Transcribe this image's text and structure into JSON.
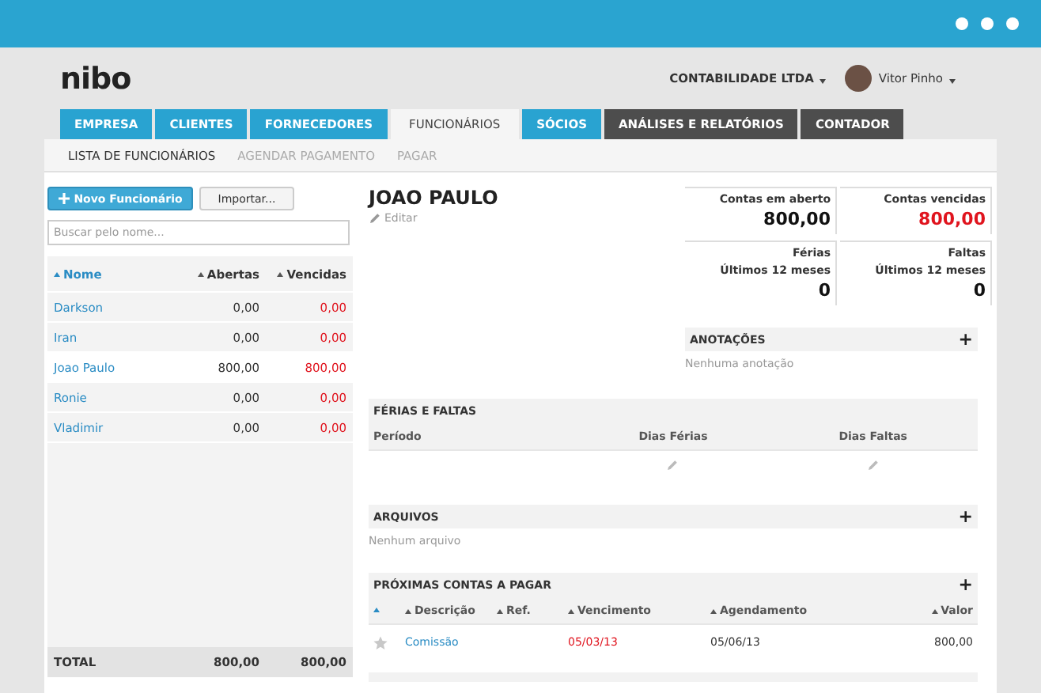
{
  "logo": "nibo",
  "account": {
    "company": "CONTABILIDADE LTDA",
    "user": "Vitor Pinho"
  },
  "tabs": [
    {
      "label": "EMPRESA",
      "selected": false,
      "kind": "module"
    },
    {
      "label": "CLIENTES",
      "selected": false,
      "kind": "module"
    },
    {
      "label": "FORNECEDORES",
      "selected": false,
      "kind": "module"
    },
    {
      "label": "FUNCIONÁRIOS",
      "selected": true,
      "kind": "module"
    },
    {
      "label": "SÓCIOS",
      "selected": false,
      "kind": "module"
    },
    {
      "label": "ANÁLISES E RELATÓRIOS",
      "selected": false,
      "kind": "tool"
    },
    {
      "label": "CONTADOR",
      "selected": false,
      "kind": "tool"
    }
  ],
  "subtabs": [
    {
      "label": "LISTA DE FUNCIONÁRIOS",
      "selected": true
    },
    {
      "label": "AGENDAR PAGAMENTO",
      "selected": false
    },
    {
      "label": "PAGAR",
      "selected": false
    }
  ],
  "sidebar": {
    "new_button": "Novo Funcionário",
    "import_button": "Importar...",
    "search": {
      "placeholder": "Buscar pelo nome..."
    },
    "columns": [
      "Nome",
      "Abertas",
      "Vencidas"
    ],
    "rows": [
      {
        "name": "Darkson",
        "open": "0,00",
        "overdue": "0,00",
        "selected": false
      },
      {
        "name": "Iran",
        "open": "0,00",
        "overdue": "0,00",
        "selected": false
      },
      {
        "name": "Joao Paulo",
        "open": "800,00",
        "overdue": "800,00",
        "selected": true
      },
      {
        "name": "Ronie",
        "open": "0,00",
        "overdue": "0,00",
        "selected": false
      },
      {
        "name": "Vladimir",
        "open": "0,00",
        "overdue": "0,00",
        "selected": false
      }
    ],
    "total": {
      "label": "TOTAL",
      "open": "800,00",
      "overdue": "800,00"
    }
  },
  "employee": {
    "name": "JOAO PAULO",
    "edit": "Editar"
  },
  "cards": [
    {
      "lines": [
        "Contas em aberto"
      ],
      "value": "800,00",
      "alert": false
    },
    {
      "lines": [
        "Contas vencidas"
      ],
      "value": "800,00",
      "alert": true
    },
    {
      "lines": [
        "Férias",
        "Últimos 12 meses"
      ],
      "value": "0",
      "alert": false
    },
    {
      "lines": [
        "Faltas",
        "Últimos 12 meses"
      ],
      "value": "0",
      "alert": false
    }
  ],
  "notes": {
    "title": "ANOTAÇÕES",
    "add": "+",
    "empty": "Nenhuma anotação"
  },
  "absences": {
    "title": "FÉRIAS E FALTAS",
    "columns": [
      "Período",
      "Dias Férias",
      "Dias Faltas"
    ]
  },
  "files": {
    "title": "ARQUIVOS",
    "add": "+",
    "empty": "Nenhum arquivo"
  },
  "payables": {
    "title": "PRÓXIMAS CONTAS A PAGAR",
    "add": "+",
    "columns": [
      "Descrição",
      "Ref.",
      "Vencimento",
      "Agendamento",
      "Valor"
    ],
    "rows": [
      {
        "description": "Comissão",
        "ref": "",
        "due": "05/03/13",
        "scheduled": "05/06/13",
        "value": "800,00",
        "overdue": true,
        "starred": false
      }
    ]
  }
}
